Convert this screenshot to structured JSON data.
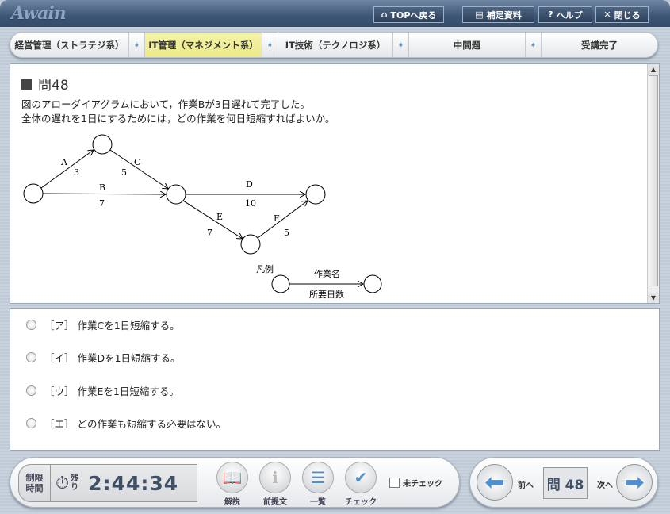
{
  "header": {
    "logo": "Awain",
    "top_label": "TOPへ戻る",
    "supplement_label": "補足資料",
    "help_label": "ヘルプ",
    "close_label": "閉じる"
  },
  "breadcrumb": [
    {
      "label": "経営管理（ストラテジ系）"
    },
    {
      "label": "IT管理（マネジメント系）",
      "active": true
    },
    {
      "label": "IT技術（テクノロジ系）"
    },
    {
      "label": "中間題"
    },
    {
      "label": "受講完了"
    }
  ],
  "question": {
    "title": "問48",
    "text1": "図のアローダイアグラムにおいて，作業Bが3日遅れて完了した。",
    "text2": "全体の遅れを1日にするためには，どの作業を何日短縮すればよいか。",
    "diagram": {
      "edges": [
        {
          "name": "A",
          "days": "3"
        },
        {
          "name": "B",
          "days": "7"
        },
        {
          "name": "C",
          "days": "5"
        },
        {
          "name": "D",
          "days": "10"
        },
        {
          "name": "E",
          "days": "7"
        },
        {
          "name": "F",
          "days": "5"
        }
      ],
      "legend": {
        "title": "凡例",
        "top": "作業名",
        "bottom": "所要日数"
      }
    }
  },
  "options": [
    {
      "label": "［ア］ 作業Cを1日短縮する。"
    },
    {
      "label": "［イ］ 作業Dを1日短縮する。"
    },
    {
      "label": "［ウ］ 作業Eを1日短縮する。"
    },
    {
      "label": "［エ］ どの作業も短縮する必要はない。"
    }
  ],
  "footer": {
    "limit_label": "制限時間",
    "remain_label": "残り",
    "time": "2:44:34",
    "explain": "解説",
    "premise": "前提文",
    "list": "一覧",
    "check": "チェック",
    "unchecked": "未チェック",
    "prev": "前へ",
    "next": "次へ",
    "question_no": "問 48"
  }
}
